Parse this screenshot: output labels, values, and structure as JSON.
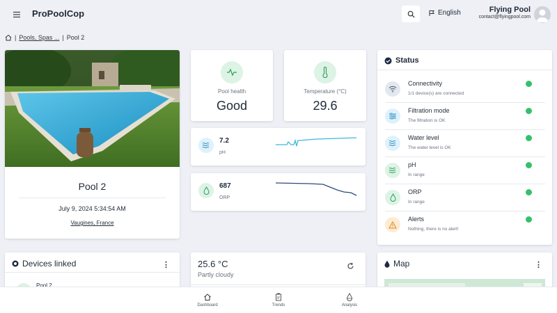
{
  "header": {
    "brand": "ProPoolCop",
    "language": "English",
    "user_name": "Flying Pool",
    "user_email": "contact@flyingpool.com"
  },
  "breadcrumb": {
    "parent": "Pools, Spas ...",
    "current": "Pool 2"
  },
  "pool": {
    "name": "Pool 2",
    "datetime": "July 9, 2024 5:34:54 AM",
    "location": "Vaugines, France"
  },
  "metrics": {
    "health_label": "Pool health",
    "health_value": "Good",
    "temp_label": "Temperature (°C)",
    "temp_value": "29.6"
  },
  "chem": {
    "ph_value": "7.2",
    "ph_unit": "pH",
    "orp_value": "687",
    "orp_unit": "ORP"
  },
  "status": {
    "title": "Status",
    "items": [
      {
        "title": "Connectivity",
        "subtitle": "1/1 device(s) are connected",
        "icon": "wifi-icon",
        "ok": true
      },
      {
        "title": "Filtration mode",
        "subtitle": "The filtration is OK",
        "icon": "sliders-icon",
        "ok": true
      },
      {
        "title": "Water level",
        "subtitle": "The water level is OK",
        "icon": "water-icon",
        "ok": true
      },
      {
        "title": "pH",
        "subtitle": "In range",
        "icon": "ph-icon",
        "ok": true
      },
      {
        "title": "ORP",
        "subtitle": "In range",
        "icon": "drop-icon",
        "ok": true
      },
      {
        "title": "Alerts",
        "subtitle": "Nothing, there is no alert!",
        "icon": "warning-icon",
        "ok": true
      }
    ]
  },
  "devices": {
    "title": "Devices linked",
    "first_device": "Pool 2"
  },
  "weather": {
    "temperature": "25.6 °C",
    "condition": "Partly cloudy"
  },
  "map": {
    "title": "Map"
  },
  "nav": {
    "dashboard": "Dashboard",
    "trends": "Trends",
    "analysis": "Analysis"
  },
  "colors": {
    "accent_green": "#34c16b",
    "icon_green_bg": "#dcf3e5",
    "icon_blue_bg": "#dff1fb",
    "ph_line": "#3bb8e0",
    "orp_line": "#2d4a7a"
  }
}
